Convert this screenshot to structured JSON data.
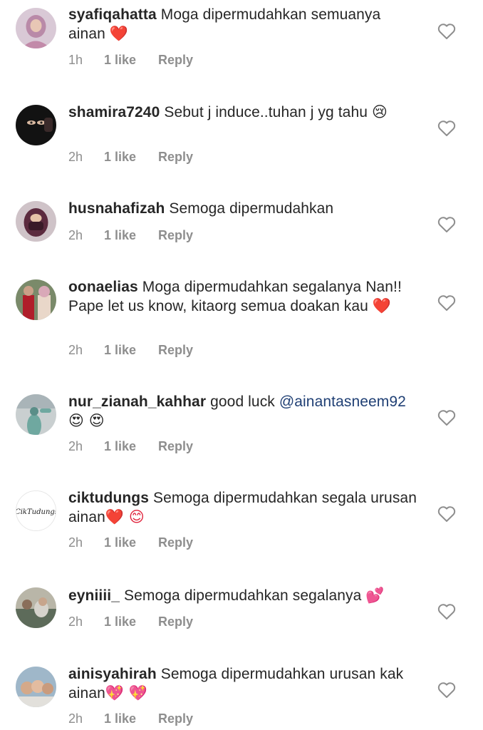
{
  "comments": [
    {
      "username": "syafiqahatta",
      "text": "Moga dipermudahkan semuanya ainan",
      "emoji": "❤️",
      "time": "1h",
      "likes": "1 like",
      "reply": "Reply"
    },
    {
      "username": "shamira7240",
      "text": "Sebut j induce..tuhan j yg tahu",
      "emoji": "😢",
      "time": "2h",
      "likes": "1 like",
      "reply": "Reply"
    },
    {
      "username": "husnahafizah",
      "text": "Semoga dipermudahkan",
      "time": "2h",
      "likes": "1 like",
      "reply": "Reply"
    },
    {
      "username": "oonaelias",
      "text": "Moga dipermudahkan segalanya Nan!! Pape let us know, kitaorg semua doakan kau",
      "emoji": "❤️",
      "time": "2h",
      "likes": "1 like",
      "reply": "Reply"
    },
    {
      "username": "nur_zianah_kahhar",
      "text": "good luck",
      "mention": "@ainantasneem92",
      "emoji": "😍 😍",
      "time": "2h",
      "likes": "1 like",
      "reply": "Reply"
    },
    {
      "username": "ciktudungs",
      "text": "Semoga dipermudahkan segala urusan ainan",
      "emoji": "❤️ 😊",
      "avatar_text": "CikTudungs",
      "time": "2h",
      "likes": "1 like",
      "reply": "Reply"
    },
    {
      "username": "eyniiii_",
      "text": "Semoga dipermudahkan segalanya",
      "emoji": "💕",
      "time": "2h",
      "likes": "1 like",
      "reply": "Reply"
    },
    {
      "username": "ainisyahirah",
      "text": "Semoga dipermudahkan urusan kak ainan",
      "emoji": "💖 💖",
      "time": "2h",
      "likes": "1 like",
      "reply": "Reply"
    }
  ],
  "icons": {
    "like": "heart-outline-icon"
  },
  "colors": {
    "text": "#262626",
    "meta": "#8e8e8e",
    "mention": "#1f3f74",
    "heart": "#e0223b"
  }
}
